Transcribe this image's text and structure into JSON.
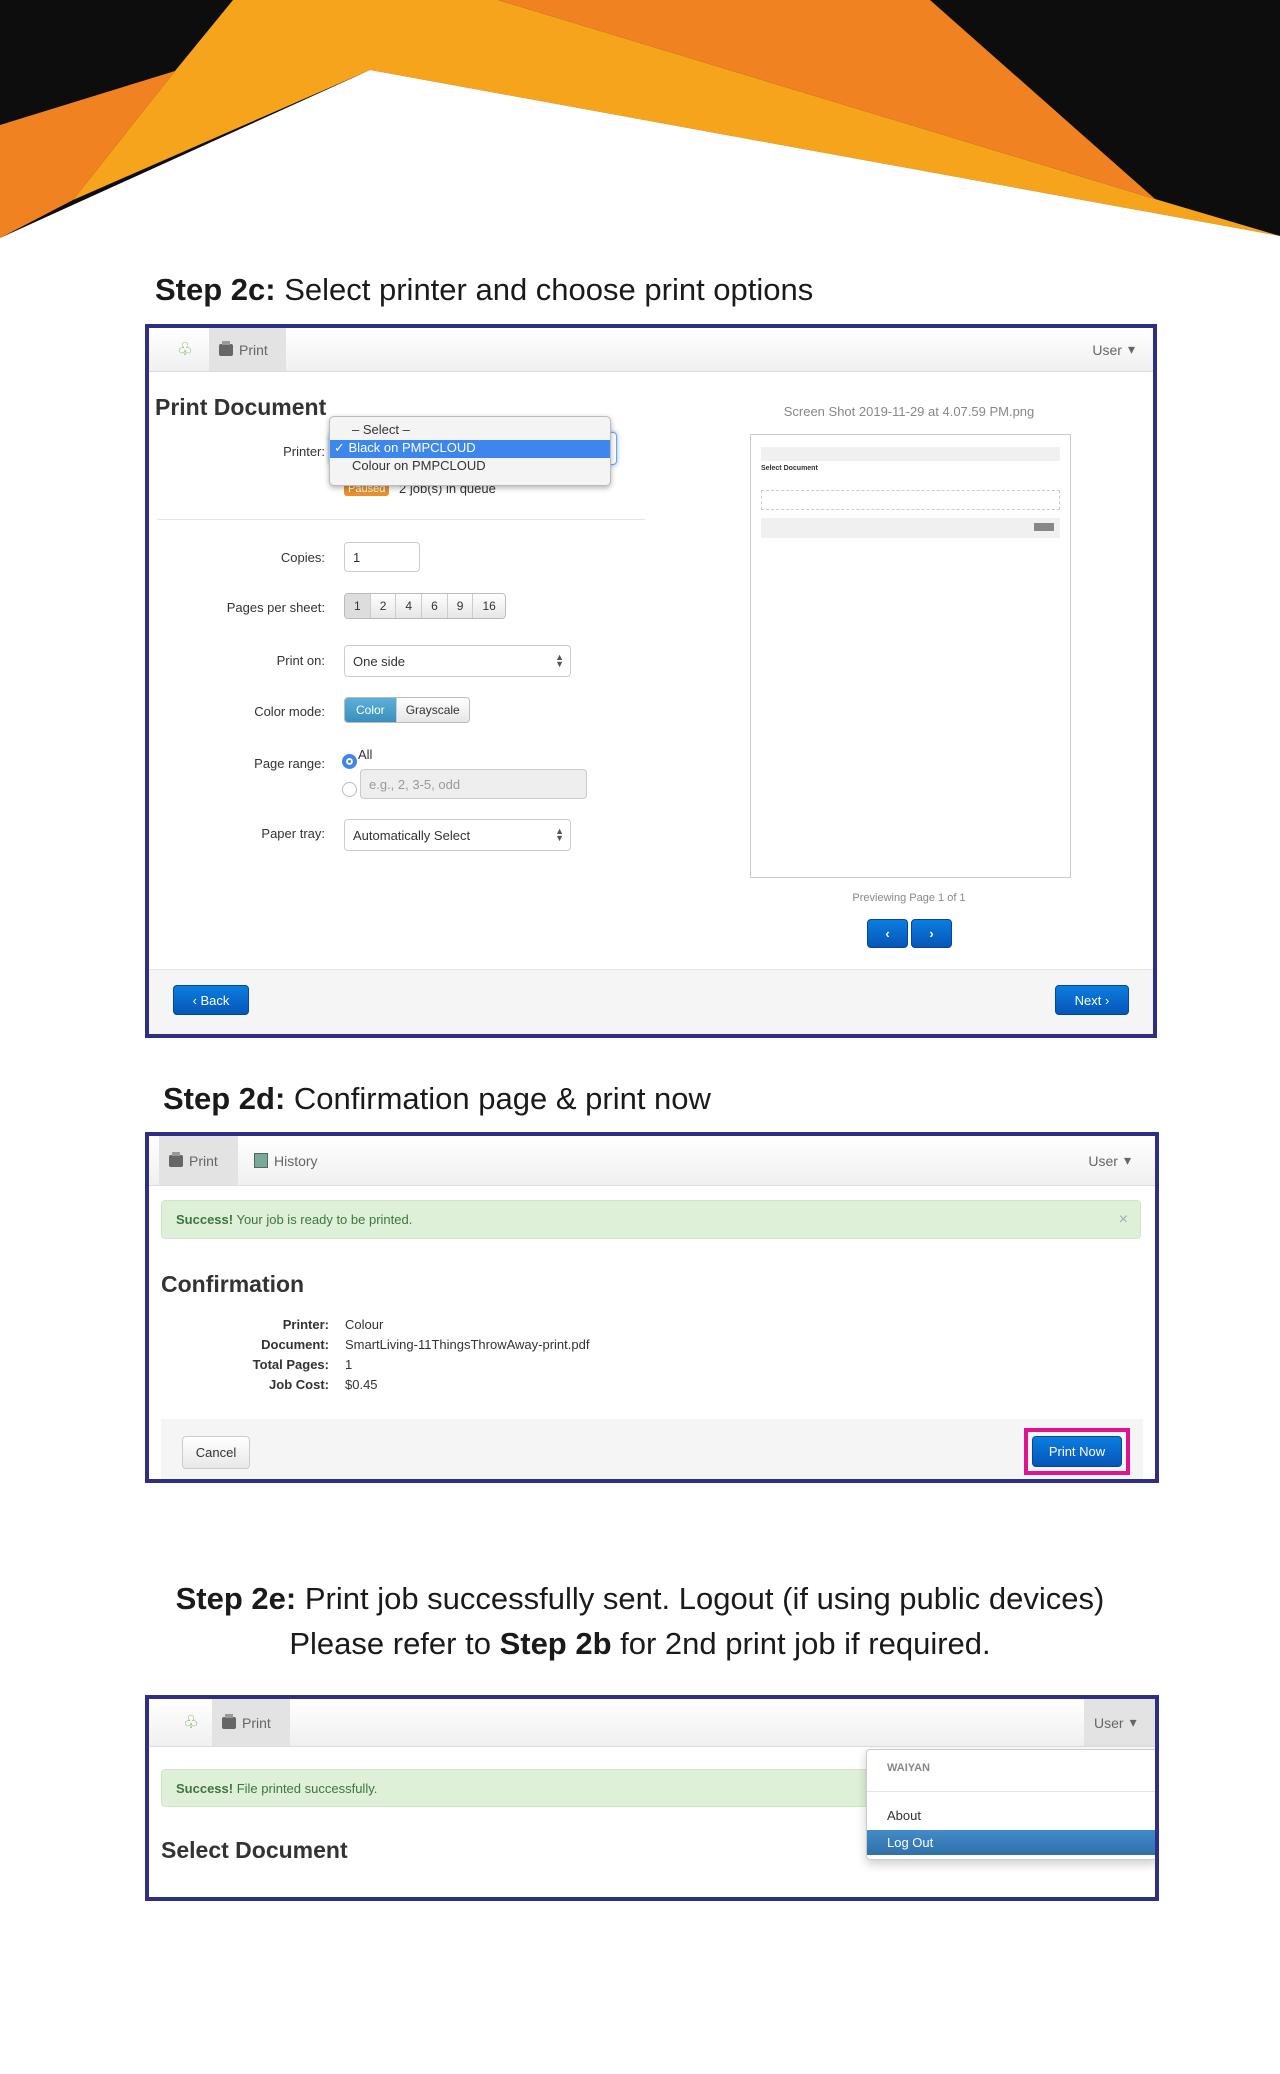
{
  "colors": {
    "frame": "#2e2f84",
    "black": "#0d0d0d",
    "orange": "#f08221",
    "yellow": "#f7a41d",
    "highlight": "#e0138c",
    "primary": "#0a6fd6"
  },
  "step2c": {
    "heading_bold": "Step 2c:",
    "heading_text": " Select printer and choose print options",
    "nav": {
      "logo_icon": "tree-icon",
      "print_tab": "Print",
      "user_menu": "User"
    },
    "title": "Print Document",
    "printer": {
      "label": "Printer:",
      "options": [
        "– Select –",
        "Black on PMPCLOUD",
        "Colour on PMPCLOUD"
      ],
      "selected": "Black on PMPCLOUD",
      "status_badge": "Paused",
      "queue": "2 job(s) in queue"
    },
    "copies": {
      "label": "Copies:",
      "value": "1"
    },
    "pages_per_sheet": {
      "label": "Pages per sheet:",
      "options": [
        "1",
        "2",
        "4",
        "6",
        "9",
        "16"
      ],
      "selected": "1"
    },
    "print_on": {
      "label": "Print on:",
      "value": "One side"
    },
    "color_mode": {
      "label": "Color mode:",
      "options": [
        "Color",
        "Grayscale"
      ],
      "selected": "Color"
    },
    "page_range": {
      "label": "Page range:",
      "all_label": "All",
      "placeholder": "e.g., 2, 3-5, odd",
      "selected": "All"
    },
    "paper_tray": {
      "label": "Paper tray:",
      "value": "Automatically Select"
    },
    "preview": {
      "filename": "Screen Shot 2019-11-29 at 4.07.59 PM.png",
      "inner_title": "Select Document",
      "page_info": "Previewing Page 1 of 1"
    },
    "back": "Back",
    "next": "Next"
  },
  "step2d": {
    "heading_bold": "Step 2d:",
    "heading_text": " Confirmation page & print now",
    "nav": {
      "print_tab": "Print",
      "history_tab": "History",
      "user_menu": "User"
    },
    "alert": {
      "strong": "Success!",
      "text": " Your job is ready to be printed.",
      "close": "×"
    },
    "title": "Confirmation",
    "details": [
      {
        "label": "Printer:",
        "value": "Colour"
      },
      {
        "label": "Document:",
        "value": "SmartLiving-11ThingsThrowAway-print.pdf"
      },
      {
        "label": "Total Pages:",
        "value": "1"
      },
      {
        "label": "Job Cost:",
        "value": "$0.45"
      }
    ],
    "cancel": "Cancel",
    "print_now": "Print Now"
  },
  "step2e": {
    "line1_bold": "Step 2e:",
    "line1_text": " Print job successfully sent. Logout (if using public devices)",
    "line2_pre": "Please refer to ",
    "line2_bold": "Step 2b",
    "line2_post": " for 2nd print job if required.",
    "nav": {
      "print_tab": "Print",
      "user_menu": "User"
    },
    "alert": {
      "strong": "Success!",
      "text": " File printed successfully."
    },
    "title": "Select Document",
    "menu": {
      "username": "WAIYAN",
      "items": [
        "About",
        "Log Out"
      ],
      "active": "Log Out"
    }
  }
}
